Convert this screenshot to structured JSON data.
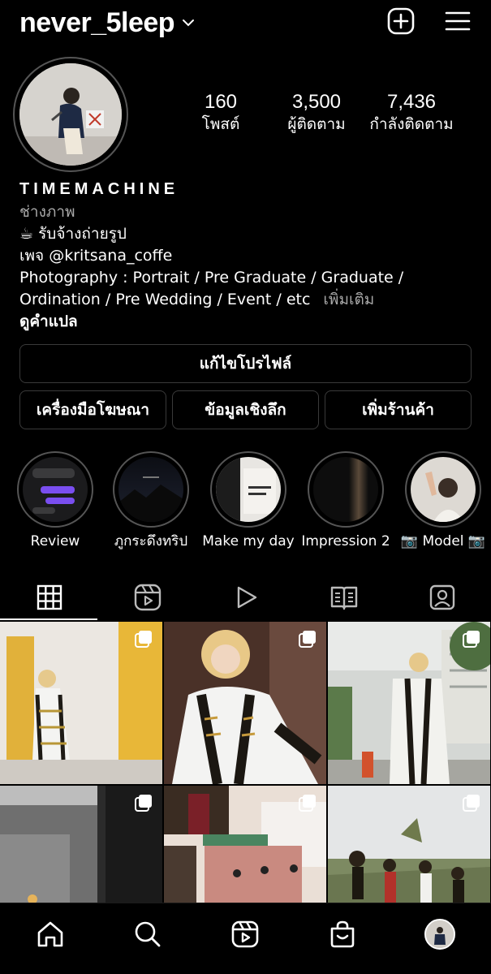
{
  "header": {
    "username": "never_5leep"
  },
  "profile": {
    "stats": [
      {
        "value": "160",
        "label": "โพสต์"
      },
      {
        "value": "3,500",
        "label": "ผู้ติดตาม"
      },
      {
        "value": "7,436",
        "label": "กำลังติดตาม"
      }
    ],
    "name": "TIMEMACHINE",
    "category": "ช่างภาพ",
    "bio_line1": "☕ รับจ้างถ่ายรูป",
    "bio_line2": "เพจ @kritsana_coffe",
    "bio_line3": "Photography : Portrait / Pre Graduate / Graduate /",
    "bio_line4": "Ordination / Pre Wedding / Event / etc",
    "more": "เพิ่มเติม",
    "translate": "ดูคำแปล"
  },
  "buttons": {
    "edit_profile": "แก้ไขโปรไฟล์",
    "ad_tools": "เครื่องมือโฆษณา",
    "insights": "ข้อมูลเชิงลึก",
    "add_shop": "เพิ่มร้านค้า"
  },
  "highlights": [
    {
      "label": "Review"
    },
    {
      "label": "ภูกระดึงทริป"
    },
    {
      "label": "Make my day"
    },
    {
      "label": "Impression 2"
    },
    {
      "label": "📷 Model 📷"
    }
  ],
  "tabs": [
    "grid-icon",
    "reels-icon",
    "video-icon",
    "guides-icon",
    "tagged-icon"
  ],
  "bottom_nav": [
    "home-icon",
    "search-icon",
    "reels-icon",
    "shop-icon",
    "profile-avatar"
  ]
}
